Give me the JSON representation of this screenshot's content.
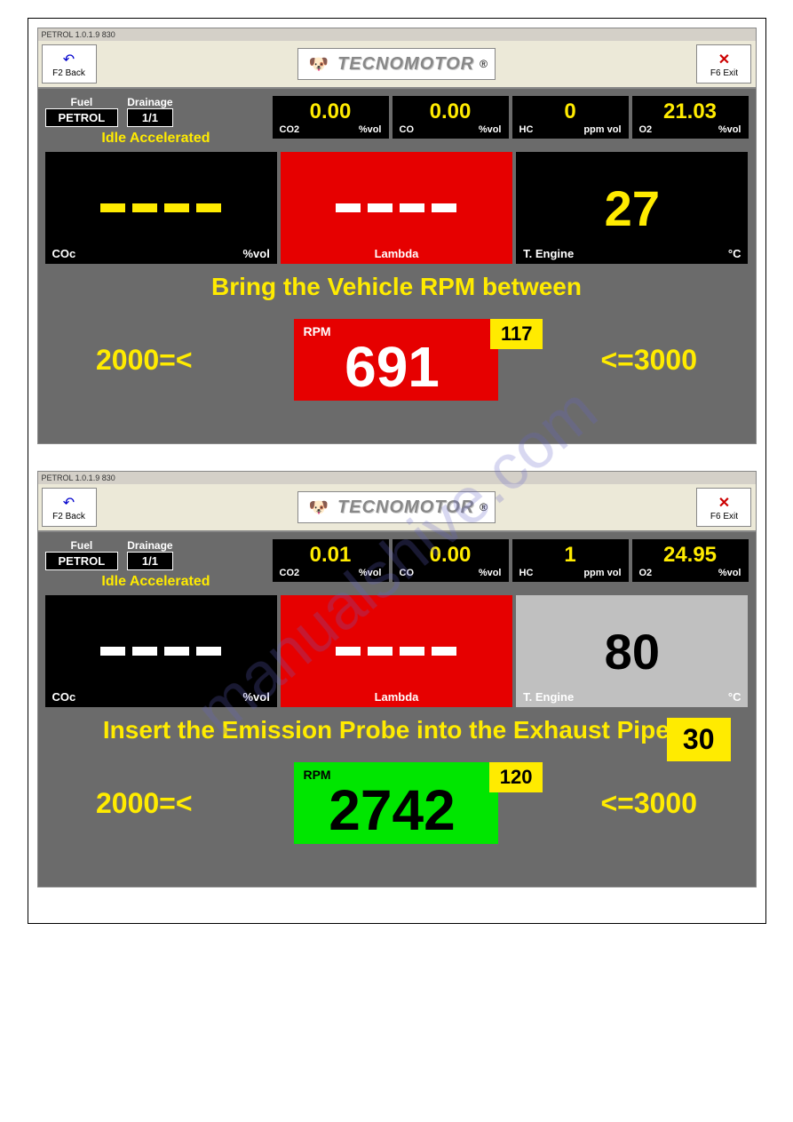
{
  "watermark": "manualshive.com",
  "screens": [
    {
      "titlebar": "PETROL 1.0.1.9  830",
      "back_label": "F2 Back",
      "exit_label": "F6 Exit",
      "logo_text": "TECNOMOTOR",
      "fuel_label": "Fuel",
      "fuel_value": "PETROL",
      "drainage_label": "Drainage",
      "drainage_value": "1/1",
      "idle_text": "Idle Accelerated",
      "gas": [
        {
          "value": "0.00",
          "name": "CO2",
          "unit": "%vol"
        },
        {
          "value": "0.00",
          "name": "CO",
          "unit": "%vol"
        },
        {
          "value": "0",
          "name": "HC",
          "unit": "ppm vol"
        },
        {
          "value": "21.03",
          "name": "O2",
          "unit": "%vol"
        }
      ],
      "big": [
        {
          "bg": "black",
          "dashes": "yellow",
          "name": "COc",
          "unit": "%vol"
        },
        {
          "bg": "red",
          "dashes": "white",
          "name": "Lambda",
          "unit": ""
        },
        {
          "bg": "black",
          "value": "27",
          "value_color": "yellow",
          "name": "T. Engine",
          "unit": "°C"
        }
      ],
      "instruction": "Bring the Vehicle RPM between",
      "range_low": "2000=<",
      "range_high": "<=3000",
      "rpm_label": "RPM",
      "rpm_value": "691",
      "rpm_badge": "117",
      "rpm_color": "red"
    },
    {
      "titlebar": "PETROL 1.0.1.9  830",
      "back_label": "F2 Back",
      "exit_label": "F6 Exit",
      "logo_text": "TECNOMOTOR",
      "fuel_label": "Fuel",
      "fuel_value": "PETROL",
      "drainage_label": "Drainage",
      "drainage_value": "1/1",
      "idle_text": "Idle Accelerated",
      "gas": [
        {
          "value": "0.01",
          "name": "CO2",
          "unit": "%vol"
        },
        {
          "value": "0.00",
          "name": "CO",
          "unit": "%vol"
        },
        {
          "value": "1",
          "name": "HC",
          "unit": "ppm vol"
        },
        {
          "value": "24.95",
          "name": "O2",
          "unit": "%vol"
        }
      ],
      "big": [
        {
          "bg": "black",
          "dashes": "white",
          "name": "COc",
          "unit": "%vol"
        },
        {
          "bg": "red",
          "dashes": "white",
          "name": "Lambda",
          "unit": ""
        },
        {
          "bg": "gray",
          "value": "80",
          "value_color": "black",
          "name": "T. Engine",
          "unit": "°C"
        }
      ],
      "instruction": "Insert the Emission Probe into the Exhaust Pipe 1",
      "range_low": "2000=<",
      "range_high": "<=3000",
      "rpm_label": "RPM",
      "rpm_value": "2742",
      "rpm_badge": "120",
      "rpm_color": "green",
      "countdown": "30"
    }
  ]
}
